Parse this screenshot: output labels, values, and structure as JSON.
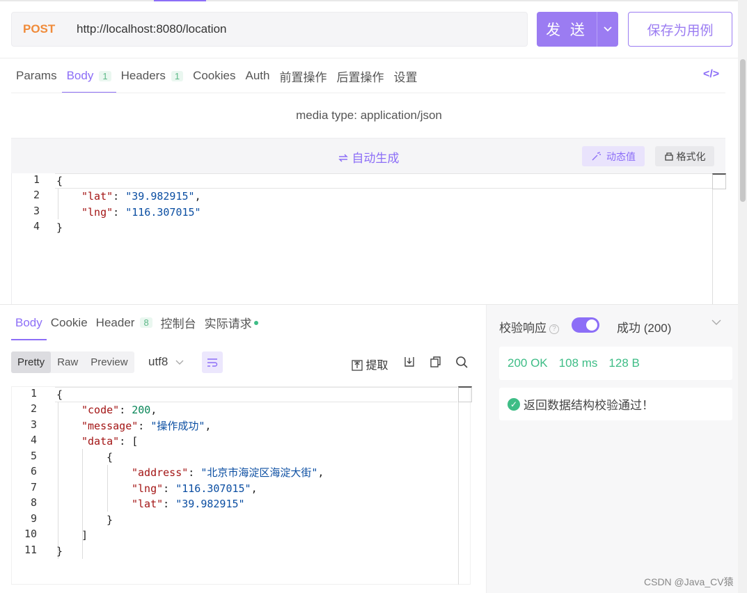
{
  "request": {
    "method": "POST",
    "url": "http://localhost:8080/location",
    "send_label": "发 送",
    "save_label": "保存为用例",
    "tabs": [
      {
        "label": "Params"
      },
      {
        "label": "Body",
        "badge": "1"
      },
      {
        "label": "Headers",
        "badge": "1"
      },
      {
        "label": "Cookies"
      },
      {
        "label": "Auth"
      },
      {
        "label": "前置操作"
      },
      {
        "label": "后置操作"
      },
      {
        "label": "设置"
      }
    ],
    "code_icon": "</>",
    "media_type": "media type: application/json",
    "auto_generate": "自动生成",
    "dynamic_value": "动态值",
    "format": "格式化",
    "body_lines": [
      "1",
      "2",
      "3",
      "4"
    ],
    "body_keys": {
      "lat": "\"lat\"",
      "lng": "\"lng\""
    },
    "body_values": {
      "lat": "\"39.982915\"",
      "lng": "\"116.307015\""
    }
  },
  "response": {
    "tabs": [
      {
        "label": "Body"
      },
      {
        "label": "Cookie"
      },
      {
        "label": "Header",
        "badge": "8"
      },
      {
        "label": "控制台"
      },
      {
        "label": "实际请求"
      }
    ],
    "view_modes": [
      "Pretty",
      "Raw",
      "Preview"
    ],
    "encoding": "utf8",
    "extract": "提取",
    "line_numbers": [
      "1",
      "2",
      "3",
      "4",
      "5",
      "6",
      "7",
      "8",
      "9",
      "10",
      "11"
    ],
    "json": {
      "code_key": "\"code\"",
      "code_val": "200",
      "message_key": "\"message\"",
      "message_val": "\"操作成功\"",
      "data_key": "\"data\"",
      "address_key": "\"address\"",
      "address_val": "\"北京市海淀区海淀大街\"",
      "lng_key": "\"lng\"",
      "lng_val": "\"116.307015\"",
      "lat_key": "\"lat\"",
      "lat_val": "\"39.982915\""
    }
  },
  "validation": {
    "label": "校验响应",
    "enabled": true,
    "result": "成功 (200)",
    "status": "200 OK",
    "time": "108 ms",
    "size": "128 B",
    "message": "返回数据结构校验通过！"
  },
  "watermark": "CSDN @Java_CV猿",
  "colors": {
    "accent": "#8c6ef7",
    "method": "#f08b3a",
    "success": "#3ebd86"
  }
}
